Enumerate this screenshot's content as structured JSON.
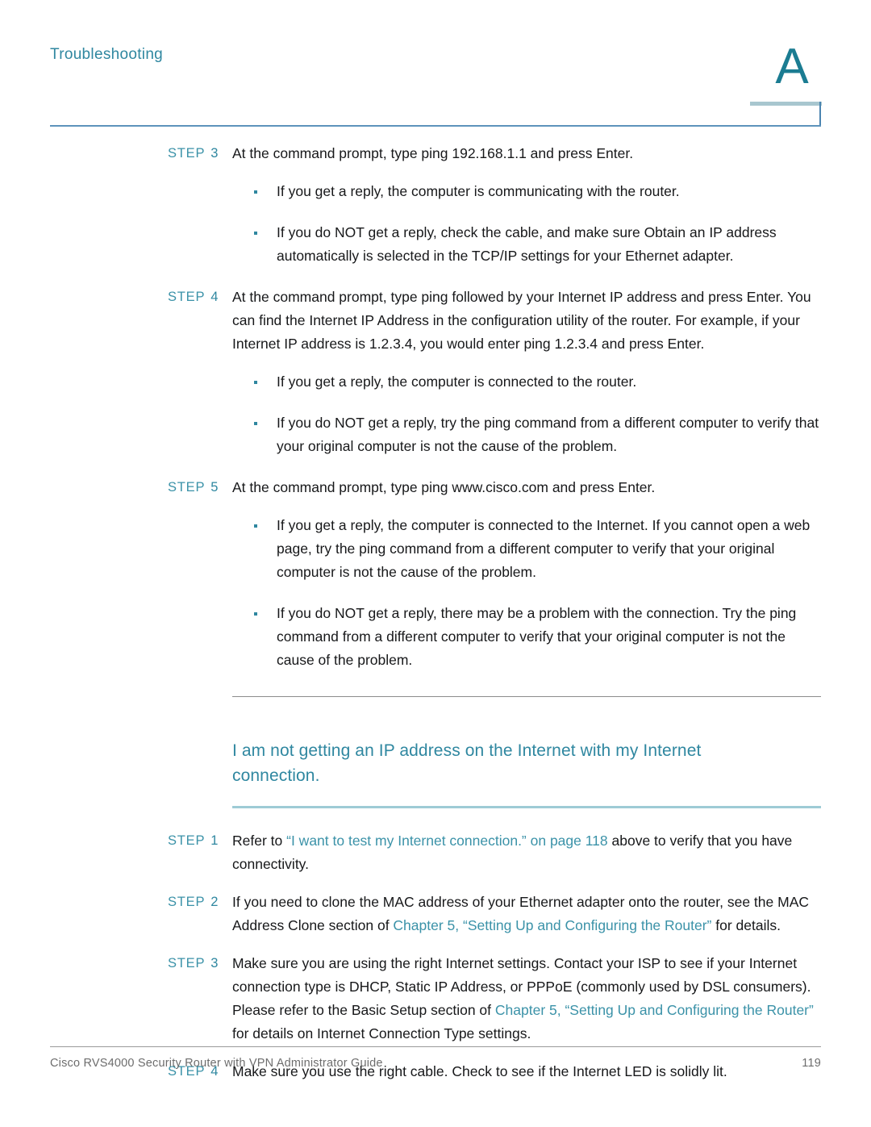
{
  "header": {
    "running_head": "Troubleshooting",
    "appendix_letter": "A"
  },
  "steps_top": [
    {
      "label_word": "STEP",
      "number": "3",
      "text": "At the command prompt, type ping 192.168.1.1 and press Enter.",
      "bullets": [
        "If you get a reply, the computer is communicating with the router.",
        "If you do NOT get a reply, check the cable, and make sure Obtain an IP address automatically is selected in the TCP/IP settings for your Ethernet adapter."
      ]
    },
    {
      "label_word": "STEP",
      "number": "4",
      "text": "At the command prompt, type ping followed by your Internet IP address and press Enter. You can find the Internet IP Address in the configuration utility of the router. For example, if your Internet IP address is 1.2.3.4, you would enter ping 1.2.3.4 and press Enter.",
      "bullets": [
        "If you get a reply, the computer is connected to the router.",
        "If you do NOT get a reply, try the ping command from a different computer to verify that your original computer is not the cause of the problem."
      ]
    },
    {
      "label_word": "STEP",
      "number": "5",
      "text": "At the command prompt, type ping www.cisco.com and press Enter.",
      "bullets": [
        "If you get a reply, the computer is connected to the Internet. If you cannot open a web page, try the ping command from a different computer to verify that your original computer is not the cause of the problem.",
        "If you do NOT get a reply, there may be a problem with the connection. Try the ping command from a different computer to verify that your original computer is not the cause of the problem."
      ]
    }
  ],
  "section": {
    "title": "I am not getting an IP address on the Internet with my Internet connection."
  },
  "steps_bottom": [
    {
      "label_word": "STEP",
      "number": "1",
      "parts": [
        {
          "text": "Refer to ",
          "link": false
        },
        {
          "text": "“I want to test my Internet connection.” on page 118",
          "link": true
        },
        {
          "text": " above to verify that you have connectivity.",
          "link": false
        }
      ]
    },
    {
      "label_word": "STEP",
      "number": "2",
      "parts": [
        {
          "text": "If you need to clone the MAC address of your Ethernet adapter onto the router, see the MAC Address Clone section of ",
          "link": false
        },
        {
          "text": "Chapter 5, “Setting Up and Configuring the Router”",
          "link": true
        },
        {
          "text": " for details.",
          "link": false
        }
      ]
    },
    {
      "label_word": "STEP",
      "number": "3",
      "parts": [
        {
          "text": "Make sure you are using the right Internet settings. Contact your ISP to see if your Internet connection type is DHCP, Static IP Address, or PPPoE (commonly used by DSL consumers). Please refer to the Basic Setup section of ",
          "link": false
        },
        {
          "text": "Chapter 5, “Setting Up and Configuring the Router”",
          "link": true
        },
        {
          "text": " for details on Internet Connection Type settings.",
          "link": false
        }
      ]
    },
    {
      "label_word": "STEP",
      "number": "4",
      "parts": [
        {
          "text": "Make sure you use the right cable. Check to see if the Internet LED is solidly lit.",
          "link": false
        }
      ]
    }
  ],
  "footer": {
    "guide_title": "Cisco RVS4000 Security Router with VPN Administrator Guide",
    "page_number": "119"
  },
  "colors": {
    "teal": "#2f87a0",
    "link_teal": "#3b92a8",
    "light_teal_rule": "#9ecbd5",
    "header_rule_blue": "#5d93bb",
    "gray_rule": "#8c8c8c",
    "footer_text": "#6d6d6d"
  }
}
